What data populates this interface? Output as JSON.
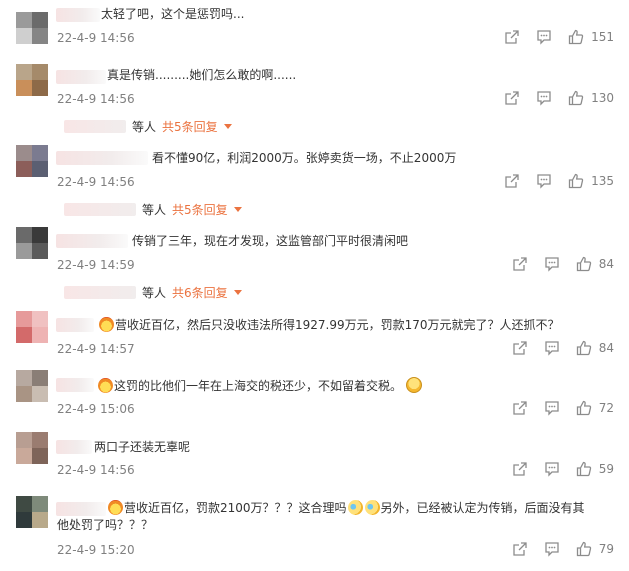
{
  "comments": [
    {
      "text": "太轻了吧，这个是惩罚吗...",
      "time": "22-4-9 14:56",
      "likes": "151",
      "avatar_colors": [
        "#9a9a9a",
        "#6b6b6b",
        "#cfcfcf",
        "#858585"
      ]
    },
    {
      "text": "真是传销.........她们怎么敢的啊......",
      "time": "22-4-9 14:56",
      "likes": "130",
      "avatar_colors": [
        "#b9a58a",
        "#a58a6a",
        "#c98f5a",
        "#8d6a48"
      ],
      "reply": {
        "who": "等人",
        "link": "共5条回复"
      }
    },
    {
      "text": "看不懂90亿，利润2000万。张婷卖货一场，不止2000万",
      "time": "22-4-9 14:56",
      "likes": "135",
      "avatar_colors": [
        "#9b8c8c",
        "#7b7b90",
        "#8c5e5a",
        "#5b5f72"
      ],
      "reply": {
        "who": "等人",
        "link": "共5条回复"
      }
    },
    {
      "text": "传销了三年，现在才发现，这监管部门平时很清闲吧",
      "time": "22-4-9 14:59",
      "likes": "84",
      "avatar_colors": [
        "#6a6a6a",
        "#3a3a3a",
        "#9a9a9a",
        "#5a5a5a"
      ],
      "reply": {
        "who": "等人",
        "link": "共6条回复"
      }
    },
    {
      "text": "营收近百亿，然后只没收违法所得1927.99万元，罚款170万元就完了？人还抓不？",
      "time": "22-4-9 14:57",
      "likes": "84",
      "avatar_colors": [
        "#e69a9a",
        "#f0c1c1",
        "#d36a6a",
        "#eeb3b3"
      ]
    },
    {
      "text": "这罚的比他们一年在上海交的税还少，不如留着交税。",
      "time": "22-4-9 15:06",
      "likes": "72",
      "avatar_colors": [
        "#b7a9a0",
        "#8a7e76",
        "#a99484",
        "#c9bdb2"
      ]
    },
    {
      "text": "两口子还装无辜呢",
      "time": "22-4-9 14:56",
      "likes": "59",
      "avatar_colors": [
        "#b89e92",
        "#9a7c70",
        "#c9a99a",
        "#7e6459"
      ]
    },
    {
      "text": "营收近百亿，罚款2100万？？？这合理吗",
      "text2": "另外，已经被认定为传销，后面没有其他处罚了吗？？？",
      "time": "22-4-9 15:20",
      "likes": "79",
      "avatar_colors": [
        "#3f4a43",
        "#7e8a7a",
        "#2f3a3b",
        "#b8a98a"
      ]
    }
  ]
}
